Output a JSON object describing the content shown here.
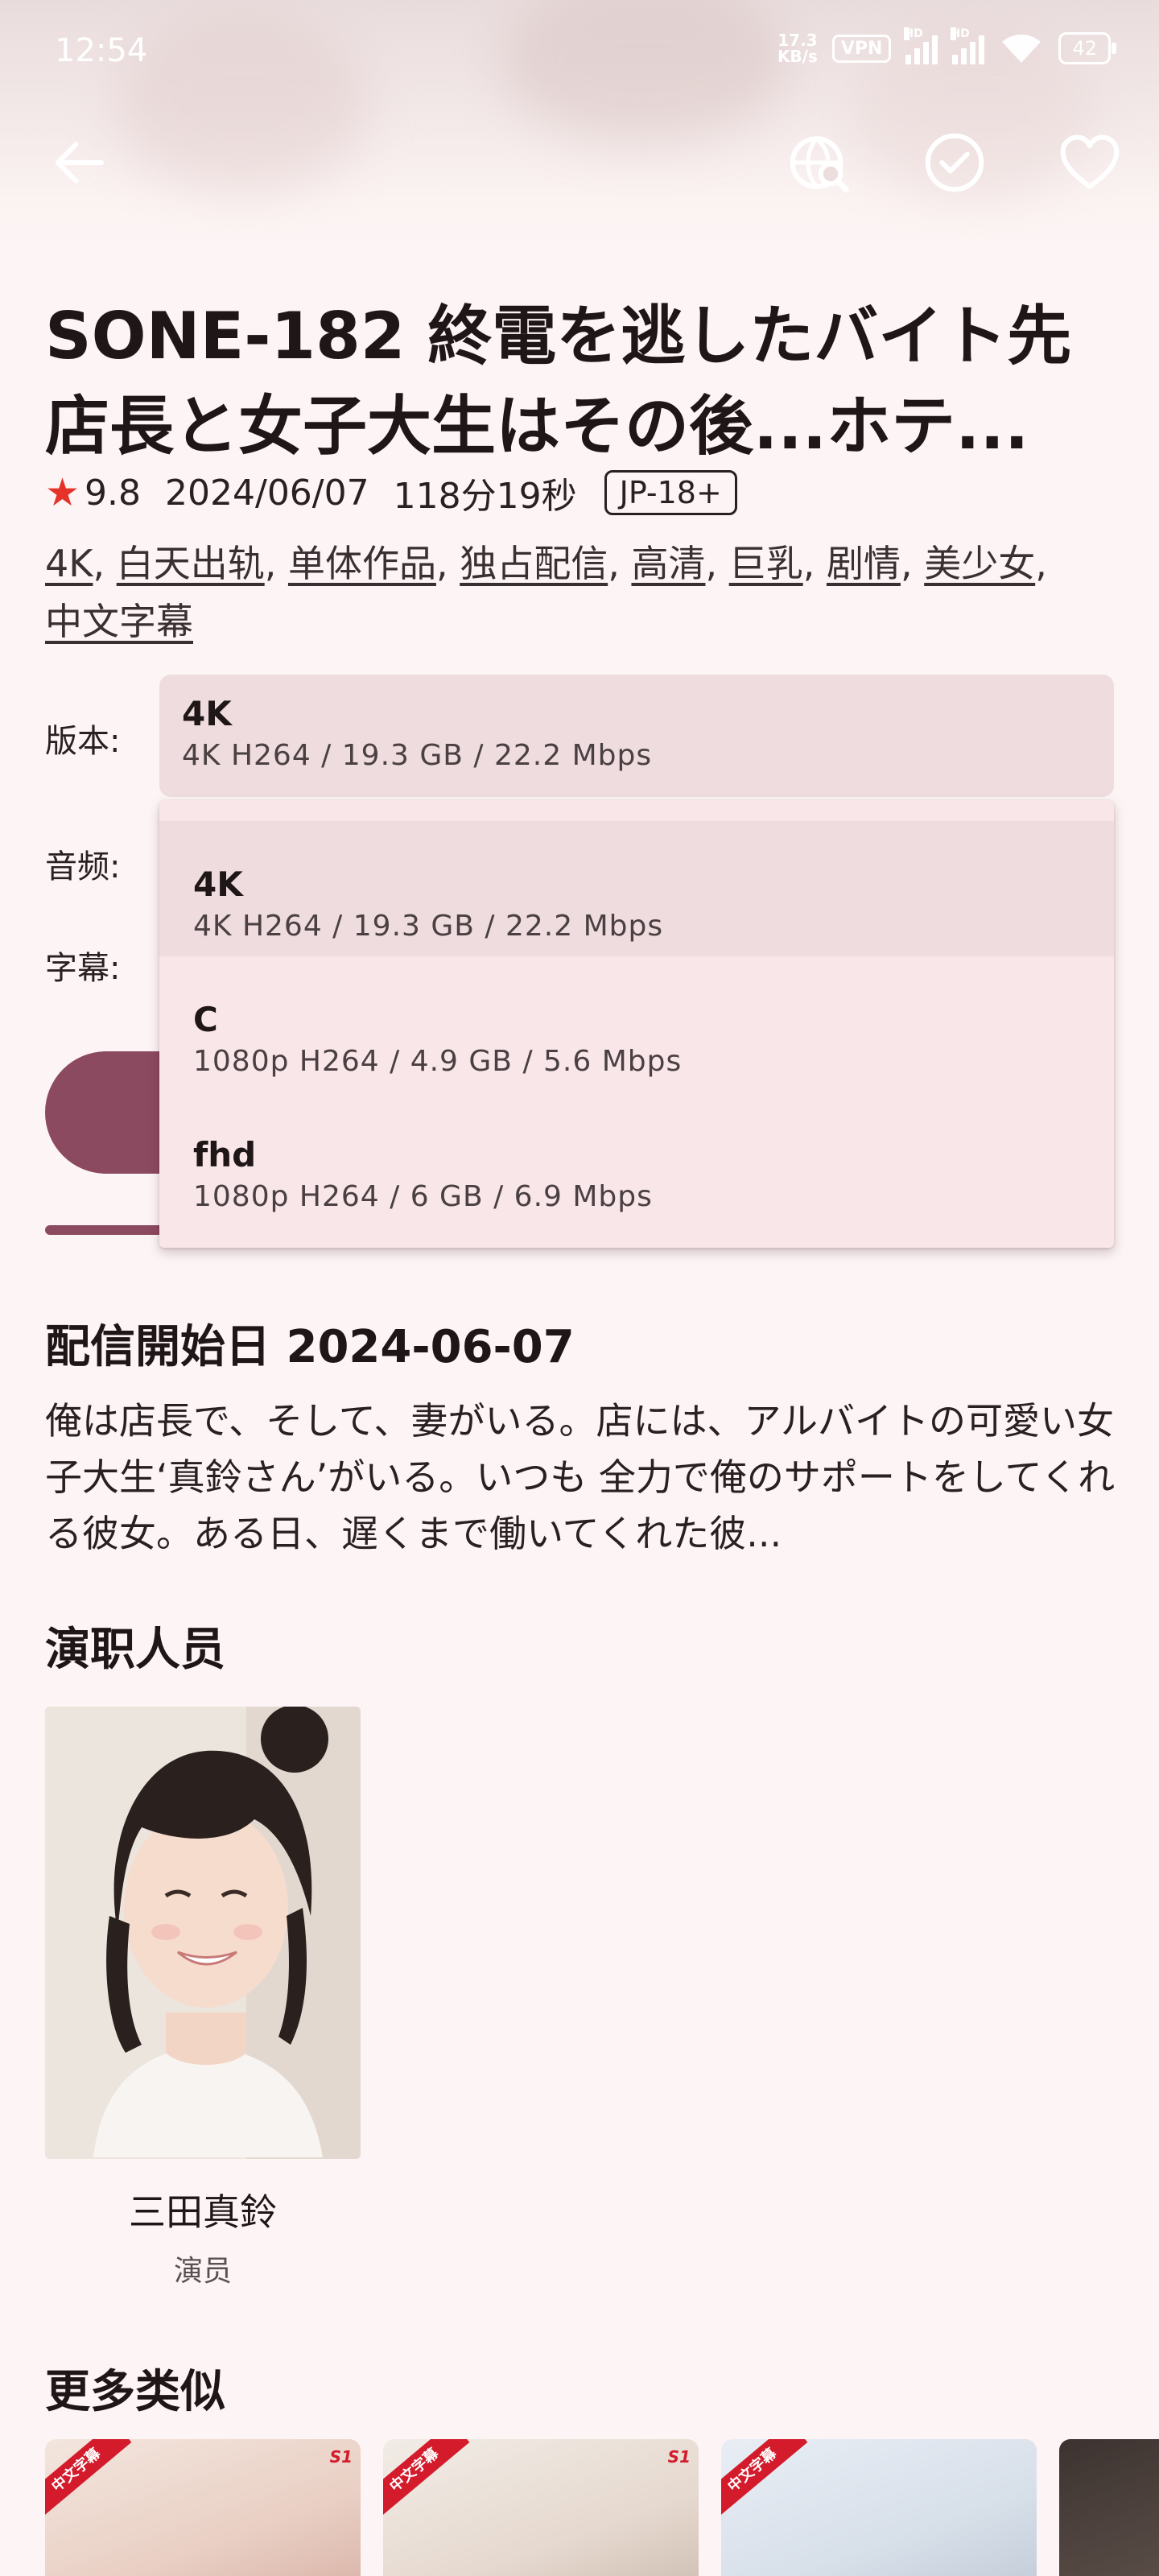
{
  "status_bar": {
    "time": "12:54",
    "net_speed_value": "17.3",
    "net_speed_unit": "KB/s",
    "vpn": "VPN",
    "hd_1": "HD",
    "hd_2": "HD",
    "battery": "42"
  },
  "app_bar": {
    "icons": [
      "back-arrow-icon",
      "search-web-icon",
      "check-circle-icon",
      "heart-icon"
    ]
  },
  "movie": {
    "title": "SONE-182 終電を逃したバイト先\n店長と女子大生はその後...ホテ...",
    "rating": "9.8",
    "date": "2024/06/07",
    "duration": "118分19秒",
    "age_rating": "JP-18+",
    "tags": [
      "4K",
      "白天出轨",
      "单体作品",
      "独占配信",
      "高清",
      "巨乳",
      "剧情",
      "美少女",
      "中文字幕"
    ]
  },
  "selectors": {
    "version_label": "版本:",
    "audio_label": "音频:",
    "subtitle_label": "字幕:",
    "version_selected": {
      "name": "4K",
      "detail": "4K H264 / 19.3 GB / 22.2 Mbps"
    },
    "version_options": [
      {
        "name": "4K",
        "detail": "4K H264 / 19.3 GB / 22.2 Mbps",
        "selected": true
      },
      {
        "name": "C",
        "detail": "1080p H264 / 4.9 GB / 5.6 Mbps",
        "selected": false
      },
      {
        "name": "fhd",
        "detail": "1080p H264 / 6 GB / 6.9 Mbps",
        "selected": false
      }
    ]
  },
  "description": {
    "heading": "配信開始日 2024-06-07",
    "text": "俺は店長で、そして、妻がいる。店には、アルバイトの可愛い女子大生‘真鈴さん’がいる。いつも 全力で俺のサポートをしてくれる彼女。ある日、遅くまで働いてくれた彼..."
  },
  "cast": {
    "heading": "演职人员",
    "members": [
      {
        "name": "三田真鈴",
        "role": "演员"
      }
    ]
  },
  "similar": {
    "heading": "更多类似",
    "badge": "中文字幕",
    "brand": "S1"
  },
  "colors": {
    "accent": "#8c4a60",
    "background": "#fdf5f5",
    "dropdown": "#f9e6e8",
    "selected_item": "#efdcde",
    "star": "#e5332a"
  }
}
